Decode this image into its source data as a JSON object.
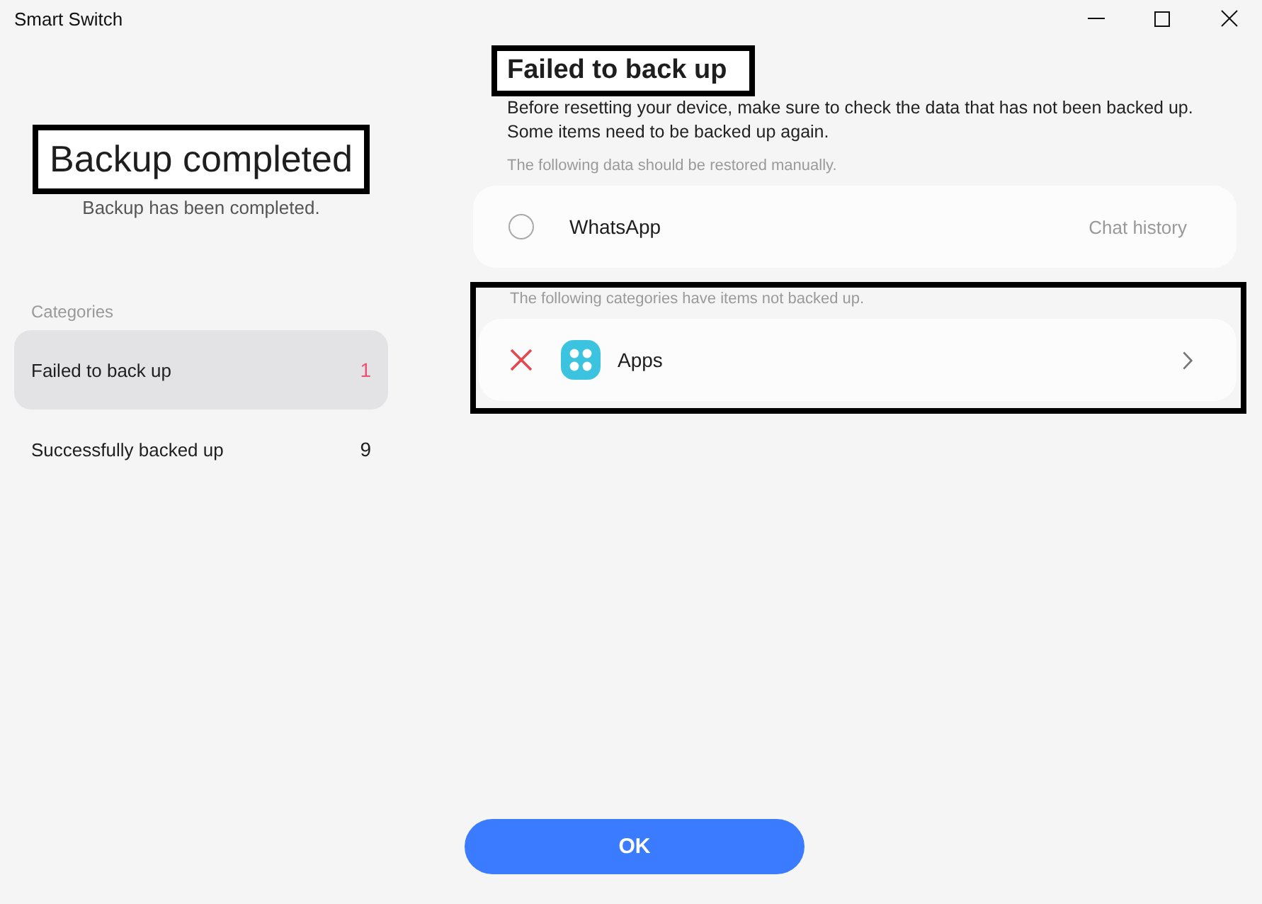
{
  "window": {
    "title": "Smart Switch"
  },
  "summary": {
    "title": "Backup completed",
    "highlighted": true,
    "subtitle": "Backup has been completed."
  },
  "categories": {
    "heading": "Categories",
    "items": [
      {
        "label": "Failed to back up",
        "count": "1",
        "kind": "failed",
        "selected": true
      },
      {
        "label": "Successfully backed up",
        "count": "9",
        "kind": "success",
        "selected": false
      }
    ]
  },
  "detail": {
    "title": "Failed to back up",
    "highlighted": true,
    "description": [
      "Before resetting your device, make sure to check the data that has not been backed up.",
      "Some items need to be backed up again."
    ]
  },
  "manual_section": {
    "note": "The following data should be restored manually.",
    "items": [
      {
        "name": "WhatsApp",
        "detail": "Chat history",
        "checked": false
      }
    ]
  },
  "failed_section": {
    "highlighted": true,
    "note": "The following categories have items not backed up.",
    "items": [
      {
        "name": "Apps",
        "failed": true
      }
    ]
  },
  "ok_button": {
    "label": "OK"
  }
}
